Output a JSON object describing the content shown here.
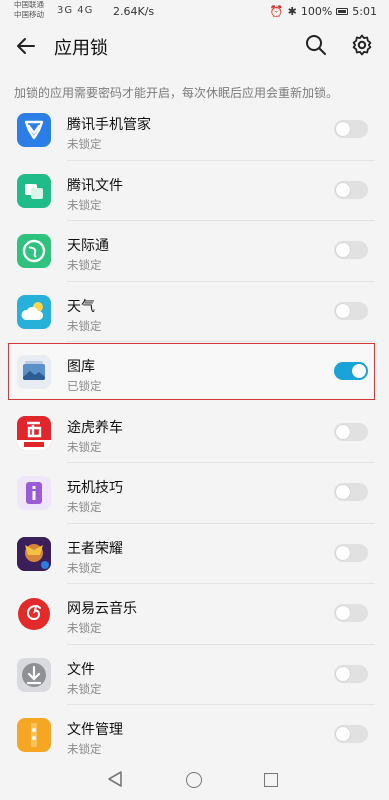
{
  "status_bar": {
    "carrier_1": "中国联通",
    "carrier_2": "中国移动",
    "signal": "3G  4G",
    "net_speed": "2.64K/s",
    "battery": "100%",
    "time": "5:01"
  },
  "header": {
    "title": "应用锁"
  },
  "hint": "加锁的应用需要密码才能开启，每次休眠后应用会重新加锁。",
  "colors": {
    "accent": "#1aa3d9",
    "highlight_border": "#d23a3a"
  },
  "apps": [
    {
      "name": "腾讯手机管家",
      "status": "未锁定",
      "locked": false,
      "icon": "tencent-manager-icon",
      "color": "#2b7ee6"
    },
    {
      "name": "腾讯文件",
      "status": "未锁定",
      "locked": false,
      "icon": "tencent-file-icon",
      "color": "#1fbc8a"
    },
    {
      "name": "天际通",
      "status": "未锁定",
      "locked": false,
      "icon": "tianjitong-icon",
      "color": "#2ec27e"
    },
    {
      "name": "天气",
      "status": "未锁定",
      "locked": false,
      "icon": "weather-icon",
      "color": "#27b1d8"
    },
    {
      "name": "图库",
      "status": "已锁定",
      "locked": true,
      "icon": "gallery-icon",
      "color": "#5b8fc7"
    },
    {
      "name": "途虎养车",
      "status": "未锁定",
      "locked": false,
      "icon": "tuhu-icon",
      "color": "#e0262b"
    },
    {
      "name": "玩机技巧",
      "status": "未锁定",
      "locked": false,
      "icon": "tips-icon",
      "color": "#9b5ad8"
    },
    {
      "name": "王者荣耀",
      "status": "未锁定",
      "locked": false,
      "icon": "honor-of-kings-icon",
      "color": "#c8572a"
    },
    {
      "name": "网易云音乐",
      "status": "未锁定",
      "locked": false,
      "icon": "netease-music-icon",
      "color": "#e22a2a"
    },
    {
      "name": "文件",
      "status": "未锁定",
      "locked": false,
      "icon": "files-icon",
      "color": "#8e9094"
    },
    {
      "name": "文件管理",
      "status": "未锁定",
      "locked": false,
      "icon": "file-manager-icon",
      "color": "#f5a623"
    }
  ]
}
